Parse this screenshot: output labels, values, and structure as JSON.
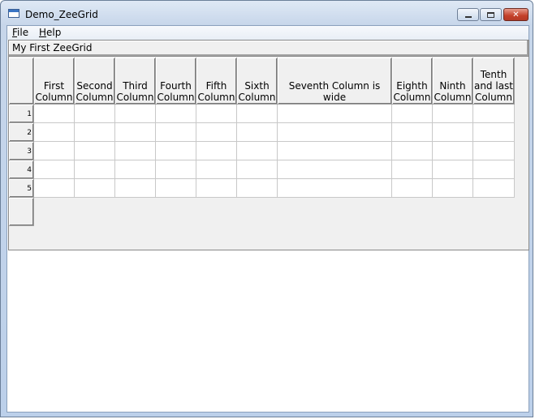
{
  "window": {
    "title": "Demo_ZeeGrid",
    "icon": "application-window-icon",
    "controls": [
      "minimize",
      "maximize",
      "close"
    ]
  },
  "menu": {
    "items": [
      {
        "label_first": "F",
        "label_rest": "ile"
      },
      {
        "label_first": "H",
        "label_rest": "elp"
      }
    ]
  },
  "grid": {
    "title": "My First ZeeGrid",
    "columns": [
      "First Column",
      "Second Column",
      "Third Column",
      "Fourth Column",
      "Fifth Column",
      "Sixth Column",
      "Seventh Column is wide",
      "Eighth Column",
      "Ninth Column",
      "Tenth and last Column"
    ],
    "rows": [
      "1",
      "2",
      "3",
      "4",
      "5"
    ],
    "colors": {
      "header": "#f0f0f0",
      "cell": "#ffffff",
      "gridline": "#c8c8c8"
    }
  }
}
